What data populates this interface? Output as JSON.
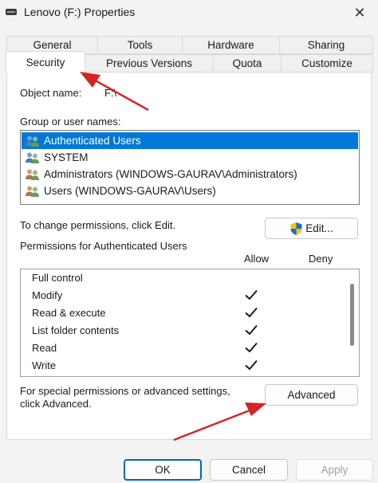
{
  "window": {
    "title": "Lenovo (F:) Properties",
    "close_glyph": "✕"
  },
  "tabs": {
    "row_back": [
      "General",
      "Tools",
      "Hardware",
      "Sharing"
    ],
    "row_front": [
      "Security",
      "Previous Versions",
      "Quota",
      "Customize"
    ],
    "selected": "Security"
  },
  "security": {
    "object_name_label": "Object name:",
    "object_name_value": "F:\\",
    "group_label": "Group or user names:",
    "users": [
      "Authenticated Users",
      "SYSTEM",
      "Administrators (WINDOWS-GAURAV\\Administrators)",
      "Users (WINDOWS-GAURAV\\Users)"
    ],
    "selected_user": "Authenticated Users",
    "change_text": "To change permissions, click Edit.",
    "edit_label": "Edit...",
    "permissions_label": "Permissions for Authenticated Users",
    "allow_header": "Allow",
    "deny_header": "Deny",
    "permissions": [
      {
        "name": "Full control",
        "allow": false,
        "deny": false
      },
      {
        "name": "Modify",
        "allow": true,
        "deny": false
      },
      {
        "name": "Read & execute",
        "allow": true,
        "deny": false
      },
      {
        "name": "List folder contents",
        "allow": true,
        "deny": false
      },
      {
        "name": "Read",
        "allow": true,
        "deny": false
      },
      {
        "name": "Write",
        "allow": true,
        "deny": false
      }
    ],
    "special_text": "For special permissions or advanced settings, click Advanced.",
    "advanced_label": "Advanced"
  },
  "footer": {
    "ok_label": "OK",
    "cancel_label": "Cancel",
    "apply_label": "Apply"
  },
  "colors": {
    "selection": "#0078d7",
    "annotation_arrow": "#d42424",
    "ok_border": "#0067c0"
  },
  "icons": {
    "user_group": "user-group-icon",
    "uac_shield": "shield-icon",
    "checkmark": "check-icon"
  }
}
